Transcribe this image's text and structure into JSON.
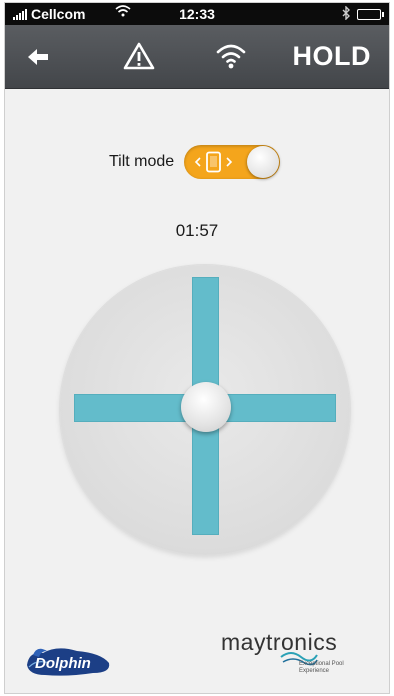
{
  "status_bar": {
    "carrier": "Cellcom",
    "time": "12:33"
  },
  "nav": {
    "back_icon": "back-arrow-icon",
    "warning_icon": "warning-triangle-icon",
    "wifi_icon": "wifi-icon",
    "hold_label": "HOLD",
    "background_color": "#4d5054"
  },
  "tilt": {
    "label": "Tilt mode",
    "toggle_on": true,
    "toggle_color": "#f4a51c",
    "toggle_icon": "phone-tilt-icon"
  },
  "timer": "01:57",
  "joystick": {
    "bar_color": "#63bccb"
  },
  "footer": {
    "dolphin_logo": "Dolphin",
    "maytronics_logo": "maytronics",
    "maytronics_tagline": "Exceptional Pool Experience"
  }
}
